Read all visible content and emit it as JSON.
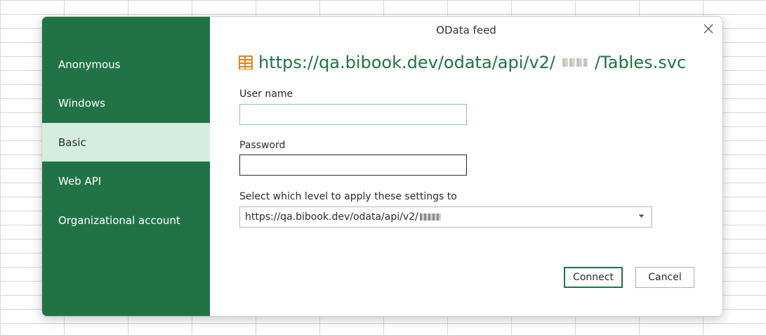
{
  "dialog": {
    "title": "OData feed",
    "url_prefix": "https://qa.bibook.dev/odata/api/v2/",
    "url_suffix": "/Tables.svc"
  },
  "sidebar": {
    "items": [
      {
        "label": "Anonymous",
        "selected": false
      },
      {
        "label": "Windows",
        "selected": false
      },
      {
        "label": "Basic",
        "selected": true
      },
      {
        "label": "Web API",
        "selected": false
      },
      {
        "label": "Organizational account",
        "selected": false
      }
    ]
  },
  "form": {
    "username_label": "User name",
    "username_value": "",
    "password_label": "Password",
    "password_value": "",
    "level_label": "Select which level to apply these settings to",
    "level_selected": "https://qa.bibook.dev/odata/api/v2/"
  },
  "buttons": {
    "connect": "Connect",
    "cancel": "Cancel"
  },
  "colors": {
    "sidebar": "#217346",
    "selected": "#d4ede0",
    "url": "#217346",
    "icon": "#e8821e"
  },
  "icons": {
    "feed": "table-icon",
    "close": "close-icon",
    "dropdown": "chevron-down-icon"
  }
}
